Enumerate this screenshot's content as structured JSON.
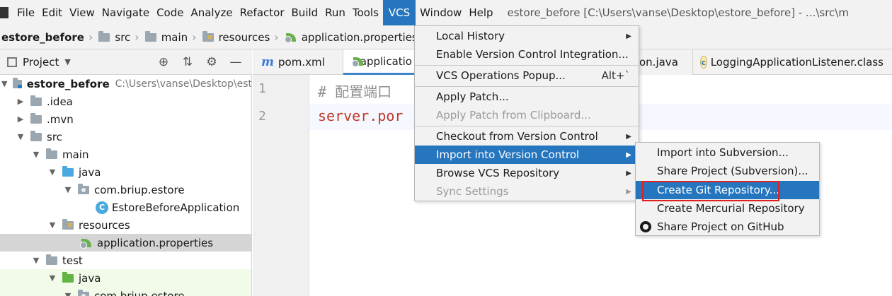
{
  "menubar": {
    "items": [
      "File",
      "Edit",
      "View",
      "Navigate",
      "Code",
      "Analyze",
      "Refactor",
      "Build",
      "Run",
      "Tools",
      "VCS",
      "Window",
      "Help"
    ],
    "active": "VCS",
    "window_title": "estore_before [C:\\Users\\vanse\\Desktop\\estore_before] - ...\\src\\m"
  },
  "breadcrumb": [
    "estore_before",
    "src",
    "main",
    "resources",
    "application.properties"
  ],
  "project_panel": {
    "title": "Project",
    "tree": [
      {
        "label": "estore_before",
        "hint": "C:\\Users\\vanse\\Desktop\\est",
        "icon": "module-folder-icon"
      },
      {
        "label": ".idea",
        "icon": "folder-icon"
      },
      {
        "label": ".mvn",
        "icon": "folder-icon"
      },
      {
        "label": "src",
        "icon": "folder-icon"
      },
      {
        "label": "main",
        "icon": "folder-icon"
      },
      {
        "label": "java",
        "icon": "source-folder-icon"
      },
      {
        "label": "com.briup.estore",
        "icon": "package-icon"
      },
      {
        "label": "EstoreBeforeApplication",
        "icon": "spring-class-icon"
      },
      {
        "label": "resources",
        "icon": "resources-folder-icon"
      },
      {
        "label": "application.properties",
        "icon": "spring-properties-icon"
      },
      {
        "label": "test",
        "icon": "folder-icon"
      },
      {
        "label": "java",
        "icon": "test-folder-icon"
      },
      {
        "label": "com.briup.estore",
        "icon": "package-icon"
      }
    ]
  },
  "tabs": [
    {
      "label": "pom.xml",
      "icon": "maven-icon"
    },
    {
      "label": "applicatio",
      "icon": "spring-properties-icon"
    },
    {
      "label": "on.java",
      "icon": "class-icon"
    },
    {
      "label": "LoggingApplicationListener.class",
      "icon": "class-file-icon"
    }
  ],
  "editor": {
    "lines": [
      {
        "no": "1",
        "text": "# 配置端口"
      },
      {
        "no": "2",
        "text": "server.por"
      }
    ]
  },
  "vcs_menu": {
    "items": [
      {
        "label": "Local History",
        "submenu": true
      },
      {
        "label": "Enable Version Control Integration...",
        "submenu": false
      },
      {
        "label": "VCS Operations Popup...",
        "shortcut": "Alt+`"
      },
      {
        "label": "Apply Patch...",
        "submenu": false
      },
      {
        "label": "Apply Patch from Clipboard...",
        "disabled": true
      },
      {
        "label": "Checkout from Version Control",
        "submenu": true
      },
      {
        "label": "Import into Version Control",
        "submenu": true,
        "highlighted": true
      },
      {
        "label": "Browse VCS Repository",
        "submenu": true
      },
      {
        "label": "Sync Settings",
        "submenu": true,
        "disabled": true
      }
    ]
  },
  "import_submenu": {
    "items": [
      {
        "label": "Import into Subversion..."
      },
      {
        "label": "Share Project (Subversion)..."
      },
      {
        "label": "Create Git Repository...",
        "highlighted": true
      },
      {
        "label": "Create Mercurial Repository"
      },
      {
        "label": "Share Project on GitHub",
        "icon": "github-icon"
      }
    ]
  },
  "colors": {
    "menu_highlight": "#2675bf",
    "annotation_box": "#e02020",
    "code_key": "#c0392b"
  }
}
